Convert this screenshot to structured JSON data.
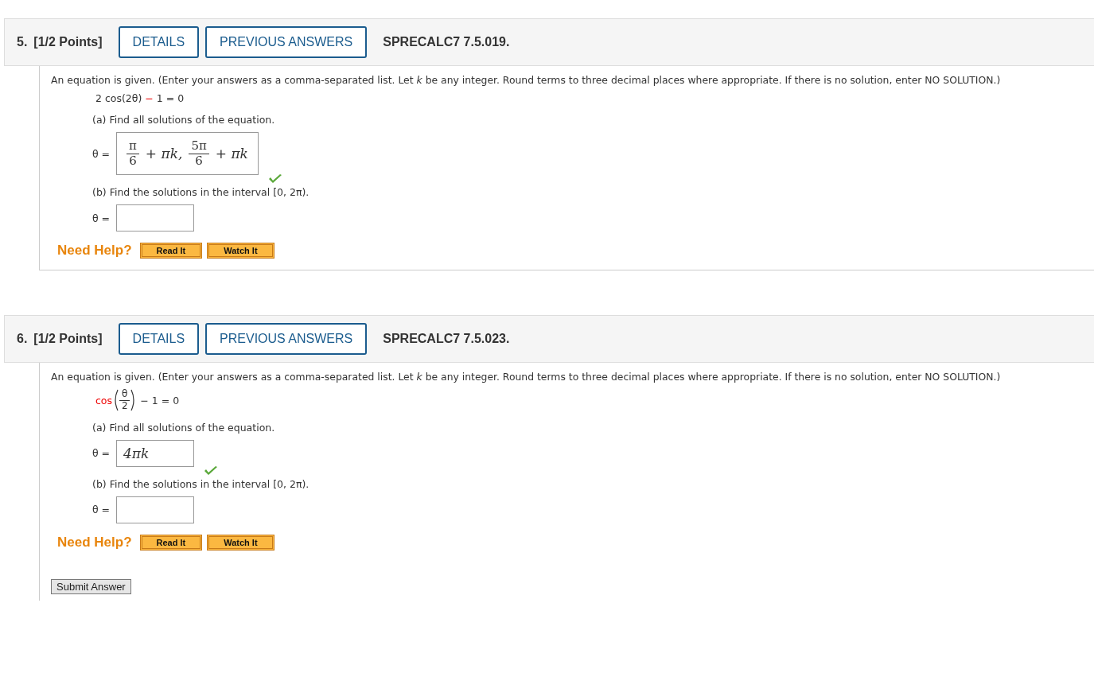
{
  "questions": [
    {
      "number": "5.",
      "points": "[1/2 Points]",
      "buttons": [
        "DETAILS",
        "PREVIOUS ANSWERS"
      ],
      "code": "SPRECALC7 7.5.019.",
      "instructions": "An equation is given. (Enter your answers as a comma-separated list. Let *k* be any integer. Round terms to three decimal places where appropriate. If there is no solution, enter NO SOLUTION.)",
      "equation": {
        "kind": "plain",
        "before": "2 cos(2θ)",
        "operator": "−",
        "after": "1 = 0"
      },
      "parts": [
        {
          "prompt": "(a) Find all solutions of the equation.",
          "label": "θ =",
          "answer": {
            "kind": "fractions",
            "terms": [
              {
                "numerator": "π",
                "denominator": "6",
                "after": "+ πk,"
              },
              {
                "numerator": "5π",
                "denominator": "6",
                "after": "+ πk"
              }
            ]
          },
          "correct": true
        },
        {
          "prompt": "(b) Find the solutions in the interval [0, 2π).",
          "label": "θ =",
          "answer": {
            "kind": "empty"
          },
          "correct": false
        }
      ],
      "help": {
        "label": "Need Help?",
        "buttons": [
          "Read It",
          "Watch It"
        ]
      }
    },
    {
      "number": "6.",
      "points": "[1/2 Points]",
      "buttons": [
        "DETAILS",
        "PREVIOUS ANSWERS"
      ],
      "code": "SPRECALC7 7.5.023.",
      "instructions": "An equation is given. (Enter your answers as a comma-separated list. Let *k* be any integer. Round terms to three decimal places where appropriate. If there is no solution, enter NO SOLUTION.)",
      "equation": {
        "kind": "function-fraction",
        "function": "cos",
        "numerator": "θ",
        "denominator": "2",
        "after": "− 1 = 0"
      },
      "parts": [
        {
          "prompt": "(a) Find all solutions of the equation.",
          "label": "θ =",
          "answer": {
            "kind": "text",
            "value": "4πk"
          },
          "correct": true
        },
        {
          "prompt": "(b) Find the solutions in the interval [0, 2π).",
          "label": "θ =",
          "answer": {
            "kind": "empty"
          },
          "correct": false
        }
      ],
      "help": {
        "label": "Need Help?",
        "buttons": [
          "Read It",
          "Watch It"
        ]
      }
    }
  ],
  "submit": "Submit Answer"
}
